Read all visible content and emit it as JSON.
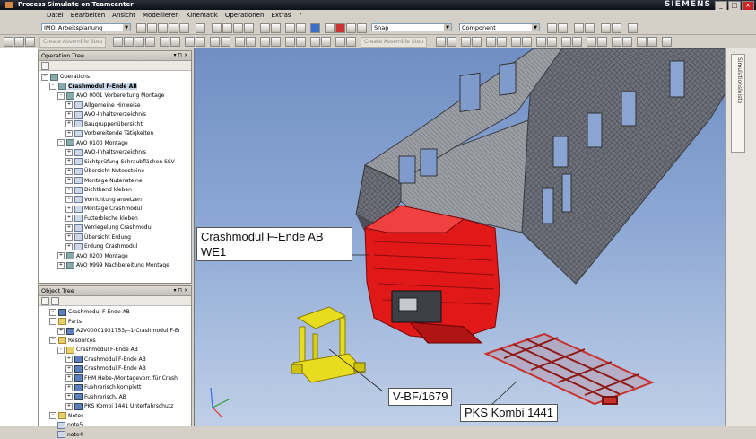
{
  "window": {
    "title": "Process Simulate on Teamcenter",
    "brand": "SIEMENS"
  },
  "menu": [
    "Datei",
    "Bearbeiten",
    "Ansicht",
    "Modellieren",
    "Kinematik",
    "Operationen",
    "Extras",
    "?"
  ],
  "toolbar": {
    "study_combo": "IMO_Arbeitsplanung",
    "snap_combo": "Snap",
    "component_combo": "Component",
    "create_assemble_step_1": "Create Assemble Step",
    "create_assemble_step_2": "Create Assemble Step"
  },
  "operation_tree": {
    "title": "Operation Tree",
    "rows": [
      {
        "label": "Operations",
        "indent": 0,
        "icon": "op",
        "exp": "-"
      },
      {
        "label": "Crashmodul F-Ende AB",
        "indent": 1,
        "icon": "op",
        "exp": "-",
        "selected": true
      },
      {
        "label": "AVO 0001 Vorbereitung Montage",
        "indent": 2,
        "icon": "op",
        "exp": "-"
      },
      {
        "label": "Allgemeine Hinweise",
        "indent": 3,
        "icon": "doc",
        "exp": "+"
      },
      {
        "label": "AVO-Inhaltsverzeichnis",
        "indent": 3,
        "icon": "doc",
        "exp": "+"
      },
      {
        "label": "Baugruppenübersicht",
        "indent": 3,
        "icon": "doc",
        "exp": "+"
      },
      {
        "label": "Vorbereitende Tätigkeiten",
        "indent": 3,
        "icon": "doc",
        "exp": "+"
      },
      {
        "label": "AVO 0100 Montage",
        "indent": 2,
        "icon": "op",
        "exp": "-"
      },
      {
        "label": "AVO-Inhaltsverzeichnis",
        "indent": 3,
        "icon": "doc",
        "exp": "+"
      },
      {
        "label": "Sichtprüfung Schraubflächen SSV",
        "indent": 3,
        "icon": "doc",
        "exp": "+"
      },
      {
        "label": "Übersicht Nutensteine",
        "indent": 3,
        "icon": "doc",
        "exp": "+"
      },
      {
        "label": "Montage Nutensteine",
        "indent": 3,
        "icon": "doc",
        "exp": "+"
      },
      {
        "label": "Dichtband kleben",
        "indent": 3,
        "icon": "doc",
        "exp": "+"
      },
      {
        "label": "Vorrichtung ansetzen",
        "indent": 3,
        "icon": "doc",
        "exp": "+"
      },
      {
        "label": "Montage Crashmodul",
        "indent": 3,
        "icon": "doc",
        "exp": "+"
      },
      {
        "label": "Futterbleche kleben",
        "indent": 3,
        "icon": "doc",
        "exp": "+"
      },
      {
        "label": "Verriegelung Crashmodul",
        "indent": 3,
        "icon": "doc",
        "exp": "+"
      },
      {
        "label": "Übersicht Erdung",
        "indent": 3,
        "icon": "doc",
        "exp": "+"
      },
      {
        "label": "Erdung Crashmodul",
        "indent": 3,
        "icon": "doc",
        "exp": "+"
      },
      {
        "label": "AVO 0200 Montage",
        "indent": 2,
        "icon": "op",
        "exp": "+"
      },
      {
        "label": "AVO 9999 Nachbereitung Montage",
        "indent": 2,
        "icon": "op",
        "exp": "+"
      }
    ]
  },
  "object_tree": {
    "title": "Object Tree",
    "rows": [
      {
        "label": "Crashmodul F-Ende AB",
        "indent": 1,
        "icon": "part",
        "exp": "-"
      },
      {
        "label": "Parts",
        "indent": 1,
        "icon": "folder",
        "exp": "-"
      },
      {
        "label": "A2V00001931753/--1-Crashmodul F-Er",
        "indent": 2,
        "icon": "part",
        "exp": "+"
      },
      {
        "label": "Resources",
        "indent": 1,
        "icon": "folder",
        "exp": "-"
      },
      {
        "label": "Crashmodul F-Ende AB",
        "indent": 2,
        "icon": "folder",
        "exp": "-"
      },
      {
        "label": "Crashmodul F-Ende AB",
        "indent": 3,
        "icon": "part",
        "exp": "+"
      },
      {
        "label": "Crashmodul F-Ende AB",
        "indent": 3,
        "icon": "part",
        "exp": "+"
      },
      {
        "label": "FHM Hebe-/Montagevorr. für Crash",
        "indent": 3,
        "icon": "part",
        "exp": "+"
      },
      {
        "label": "Fuehrerisch komplett",
        "indent": 3,
        "icon": "part",
        "exp": "+"
      },
      {
        "label": "Fuehrerisch, AB",
        "indent": 3,
        "icon": "part",
        "exp": "+"
      },
      {
        "label": "PKS Kombi 1441 Unterfahrschutz",
        "indent": 3,
        "icon": "part",
        "exp": "+"
      },
      {
        "label": "Notes",
        "indent": 1,
        "icon": "folder",
        "exp": "-"
      },
      {
        "label": "note5",
        "indent": 2,
        "icon": "doc",
        "exp": ""
      },
      {
        "label": "note4",
        "indent": 2,
        "icon": "doc",
        "exp": ""
      }
    ]
  },
  "viewport": {
    "callout_crash_line1": "Crashmodul F-Ende AB",
    "callout_crash_line2": "WE1",
    "callout_vbf": "V-BF/1679",
    "callout_pks": "PKS Kombi 1441",
    "side_tab": "Simulationsleiste",
    "colors": {
      "crash": "#e01818",
      "fixture": "#e7dc1e",
      "frame": "#c8322c",
      "body": "#5d6068"
    }
  }
}
